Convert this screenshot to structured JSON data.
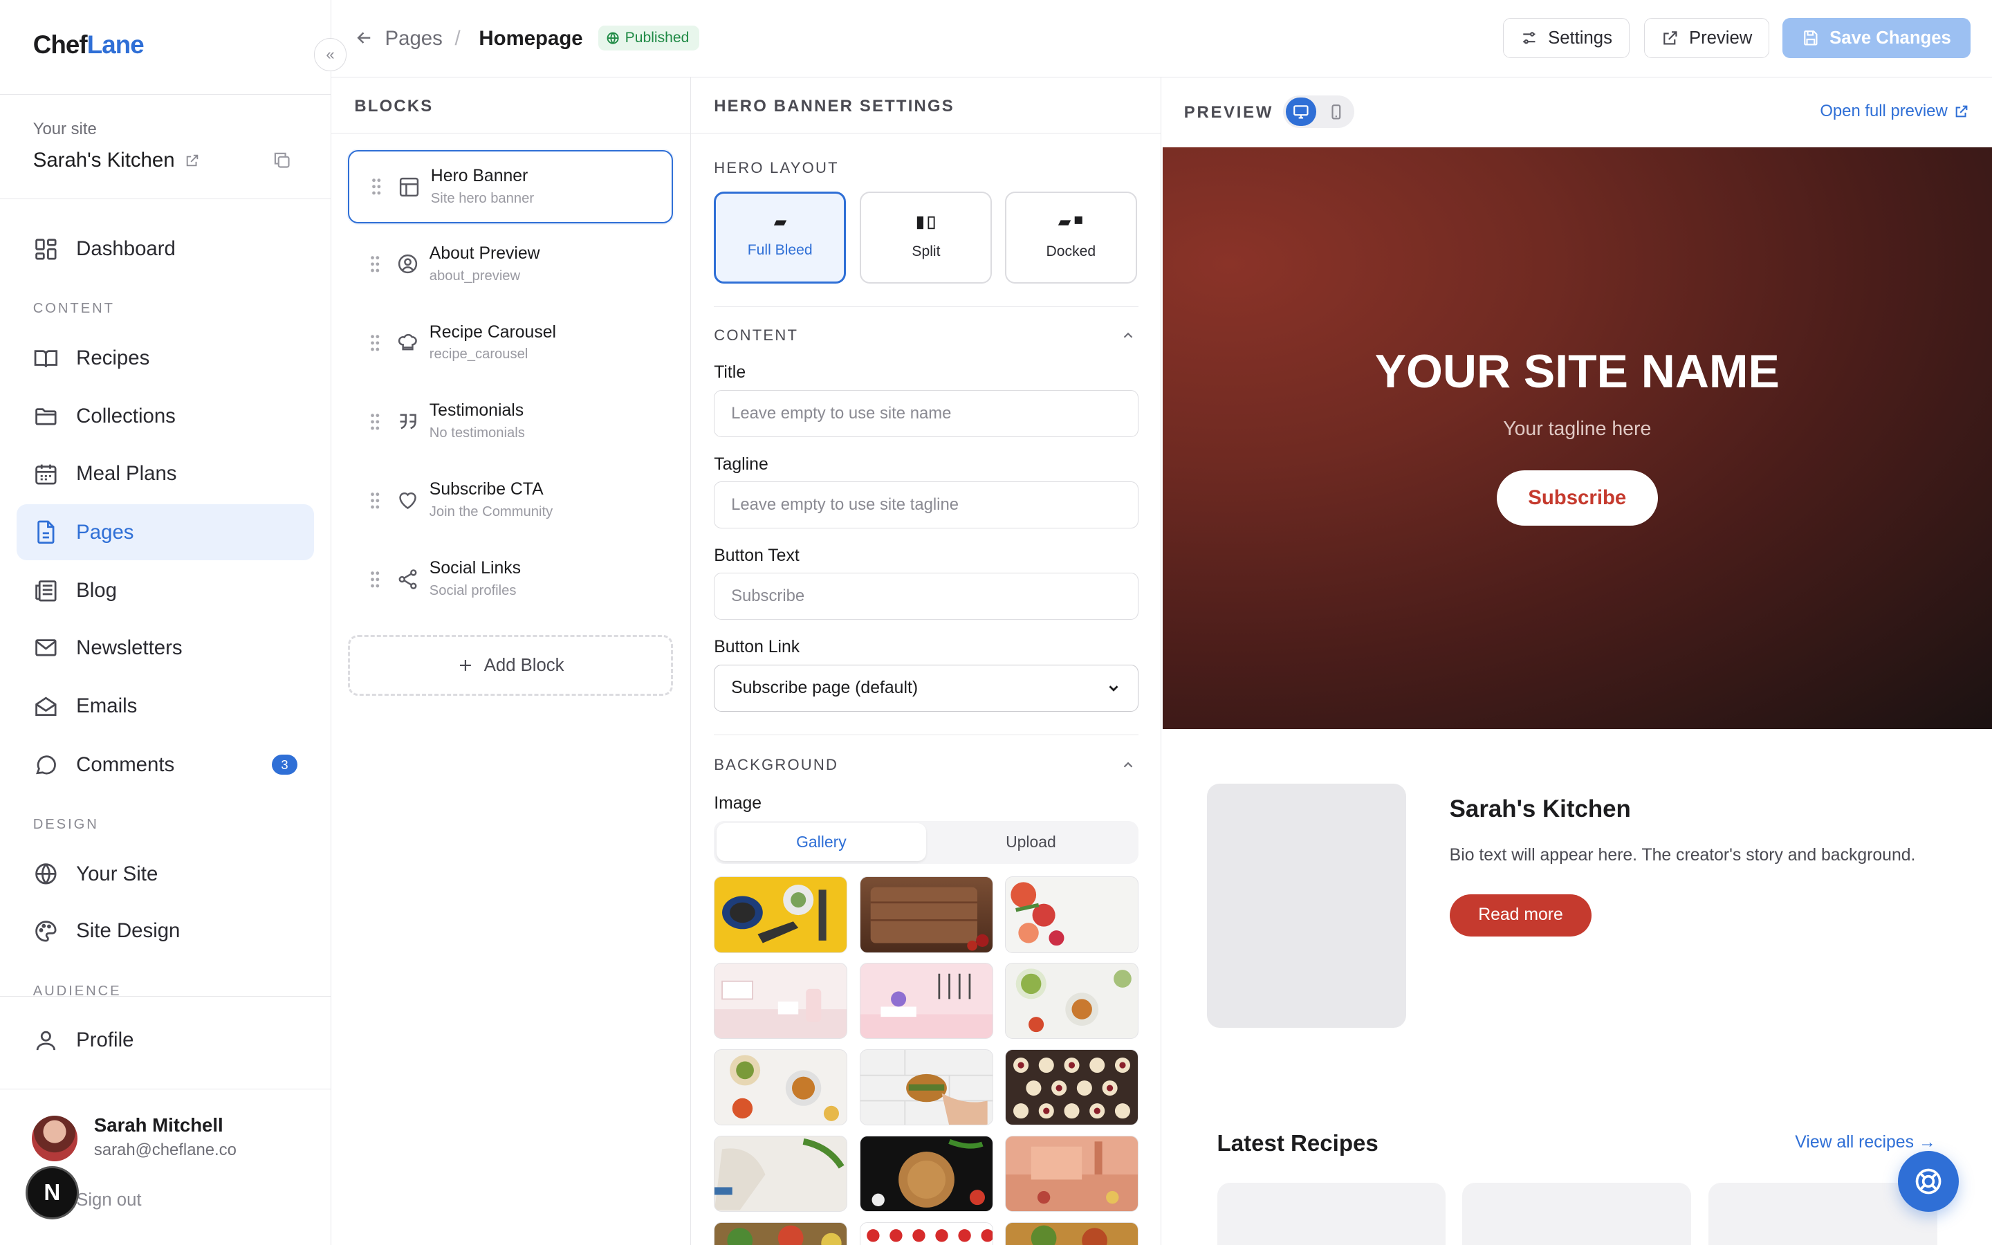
{
  "app": {
    "logo_part1": "Chef",
    "logo_part2": "Lane",
    "collapse_glyph": "«"
  },
  "sidebar": {
    "site_label": "Your site",
    "site_name": "Sarah's Kitchen",
    "primary_item": {
      "label": "Dashboard",
      "icon": "dashboard-icon"
    },
    "sections": {
      "content": "CONTENT",
      "design": "DESIGN",
      "audience": "AUDIENCE"
    },
    "content_items": [
      {
        "label": "Recipes",
        "icon": "book-open-icon"
      },
      {
        "label": "Collections",
        "icon": "folder-icon"
      },
      {
        "label": "Meal Plans",
        "icon": "calendar-icon"
      },
      {
        "label": "Pages",
        "icon": "file-icon",
        "active": true
      },
      {
        "label": "Blog",
        "icon": "newspaper-icon"
      },
      {
        "label": "Newsletters",
        "icon": "mail-icon"
      },
      {
        "label": "Emails",
        "icon": "mail-open-icon"
      },
      {
        "label": "Comments",
        "icon": "message-circle-icon",
        "badge": "3"
      }
    ],
    "design_items": [
      {
        "label": "Your Site",
        "icon": "globe-icon"
      },
      {
        "label": "Site Design",
        "icon": "palette-icon"
      }
    ],
    "profile_item": {
      "label": "Profile",
      "icon": "user-icon"
    },
    "user": {
      "name": "Sarah Mitchell",
      "email": "sarah@cheflane.co",
      "sign_out": "Sign out"
    },
    "n_badge": "N"
  },
  "topbar": {
    "crumb_parent": "Pages",
    "crumb_sep": "/",
    "crumb_current": "Homepage",
    "status": "Published",
    "settings_label": "Settings",
    "preview_label": "Preview",
    "save_label": "Save Changes"
  },
  "blocks": {
    "heading": "BLOCKS",
    "items": [
      {
        "title": "Hero Banner",
        "subtitle": "Site hero banner",
        "icon": "layout-icon",
        "selected": true
      },
      {
        "title": "About Preview",
        "subtitle": "about_preview",
        "icon": "user-circle-icon"
      },
      {
        "title": "Recipe Carousel",
        "subtitle": "recipe_carousel",
        "icon": "chef-hat-icon"
      },
      {
        "title": "Testimonials",
        "subtitle": "No testimonials",
        "icon": "quote-icon"
      },
      {
        "title": "Subscribe CTA",
        "subtitle": "Join the Community",
        "icon": "heart-icon"
      },
      {
        "title": "Social Links",
        "subtitle": "Social profiles",
        "icon": "share-icon"
      }
    ],
    "add_label": "Add Block"
  },
  "settings": {
    "heading": "HERO BANNER SETTINGS",
    "layout_label": "HERO LAYOUT",
    "layouts": [
      {
        "label": "Full Bleed",
        "selected": true
      },
      {
        "label": "Split"
      },
      {
        "label": "Docked"
      }
    ],
    "content_section": "CONTENT",
    "title_label": "Title",
    "title_placeholder": "Leave empty to use site name",
    "tagline_label": "Tagline",
    "tagline_placeholder": "Leave empty to use site tagline",
    "button_text_label": "Button Text",
    "button_text_placeholder": "Subscribe",
    "button_link_label": "Button Link",
    "button_link_value": "Subscribe page (default)",
    "background_section": "BACKGROUND",
    "image_label": "Image",
    "tabs": [
      "Gallery",
      "Upload"
    ],
    "active_tab": "Gallery"
  },
  "preview": {
    "label": "PREVIEW",
    "open_full": "Open full preview",
    "hero": {
      "title": "YOUR SITE NAME",
      "tagline": "Your tagline here",
      "button": "Subscribe"
    },
    "about": {
      "name": "Sarah's Kitchen",
      "bio": "Bio text will appear here. The creator's story and background.",
      "button": "Read more"
    },
    "latest": {
      "title": "Latest Recipes",
      "view_all": "View all recipes →"
    }
  },
  "colors": {
    "accent": "#2f6fd6",
    "brand_red": "#c53a2e",
    "published_green": "#1f8a45"
  }
}
